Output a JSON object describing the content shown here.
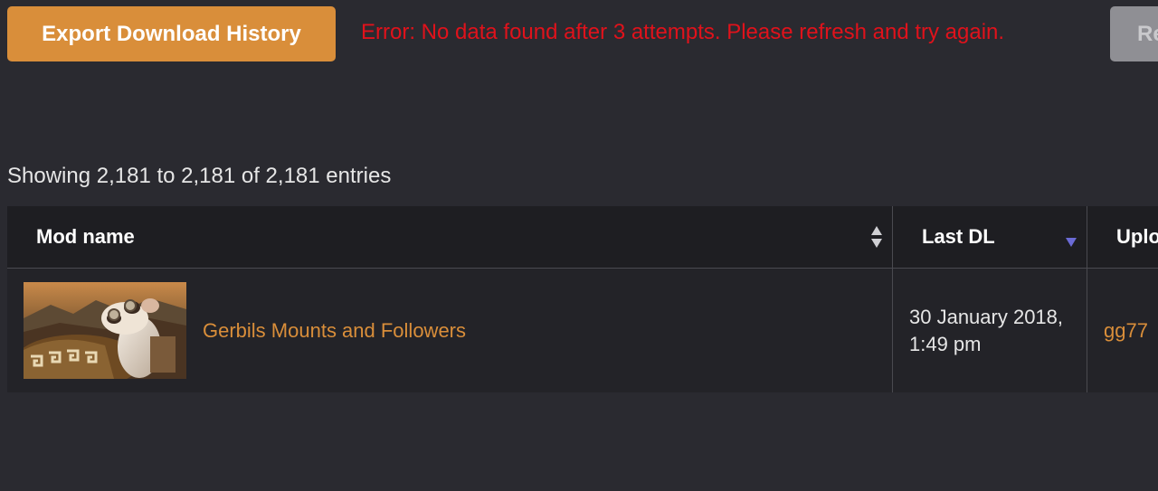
{
  "toolbar": {
    "export_label": "Export Download History",
    "error_message": "Error: No data found after 3 attempts. Please refresh and try again.",
    "refresh_label": "Re"
  },
  "table_info": {
    "showing": "Showing 2,181 to 2,181 of 2,181 entries"
  },
  "table": {
    "columns": [
      {
        "label": "Mod name",
        "sort": "none"
      },
      {
        "label": "Last DL",
        "sort": "descending"
      },
      {
        "label": "Uplo"
      }
    ],
    "rows": [
      {
        "thumbnail_icon": "gerbil-mod-thumbnail",
        "mod_name": "Gerbils Mounts and Followers",
        "last_dl": "30 January 2018, 1:49 pm",
        "uploader": "gg77"
      }
    ]
  },
  "colors": {
    "accent": "#d98e3a",
    "error": "#e0121b",
    "background": "#2a2a30",
    "header_bg": "#1e1e22",
    "sort_active": "#6b6bd6"
  }
}
